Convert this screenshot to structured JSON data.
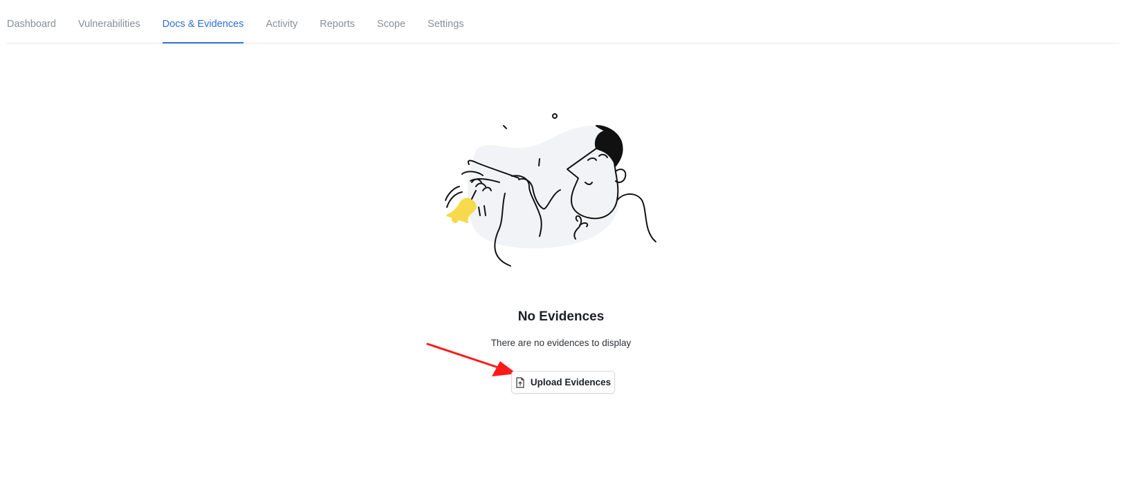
{
  "tabs": [
    {
      "label": "Dashboard",
      "active": false
    },
    {
      "label": "Vulnerabilities",
      "active": false
    },
    {
      "label": "Docs & Evidences",
      "active": true
    },
    {
      "label": "Activity",
      "active": false
    },
    {
      "label": "Reports",
      "active": false
    },
    {
      "label": "Scope",
      "active": false
    },
    {
      "label": "Settings",
      "active": false
    }
  ],
  "empty_state": {
    "title": "No Evidences",
    "description": "There are no evidences to display",
    "illustration": "person-ringing-bell-illustration"
  },
  "upload_button": {
    "label": "Upload Evidences",
    "icon": "file-upload-icon"
  },
  "annotation": {
    "icon": "red-arrow-pointer",
    "color": "#ff1a1a"
  },
  "colors": {
    "accent": "#2b6fd6",
    "tab_inactive": "#8a8f98",
    "bell": "#f7d94c",
    "arrow": "#ff1a1a"
  }
}
